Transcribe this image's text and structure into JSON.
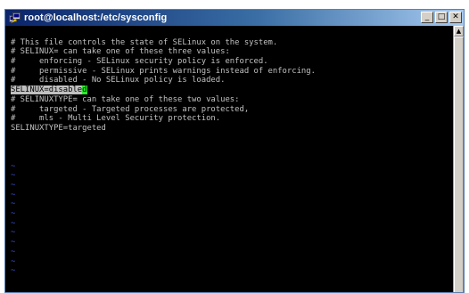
{
  "window": {
    "title": "root@localhost:/etc/sysconfig",
    "controls": {
      "minimize_glyph": "_",
      "maximize_glyph": "□",
      "close_glyph": "✕"
    }
  },
  "colors": {
    "terminal_bg": "#000000",
    "terminal_text": "#c0c0c0",
    "cursor": "#2ee92e",
    "tilde": "#3a4fd0"
  },
  "terminal": {
    "lines": [
      "",
      "# This file controls the state of SELinux on the system.",
      "# SELINUX= can take one of these three values:",
      "#     enforcing - SELinux security policy is enforced.",
      "#     permissive - SELinux prints warnings instead of enforcing.",
      "#     disabled - No SELinux policy is loaded.",
      "",
      "# SELINUXTYPE= can take one of these two values:",
      "#     targeted - Targeted processes are protected,",
      "#     mls - Multi Level Security protection.",
      "SELINUXTYPE=targeted",
      "",
      "",
      "",
      "~",
      "~",
      "~",
      "~",
      "~",
      "~",
      "~",
      "~",
      "~",
      "~",
      "~",
      "~"
    ],
    "edit_line": {
      "index": 6,
      "text_before_cursor": "SELINUX=disable",
      "cursor_char": "d"
    }
  }
}
